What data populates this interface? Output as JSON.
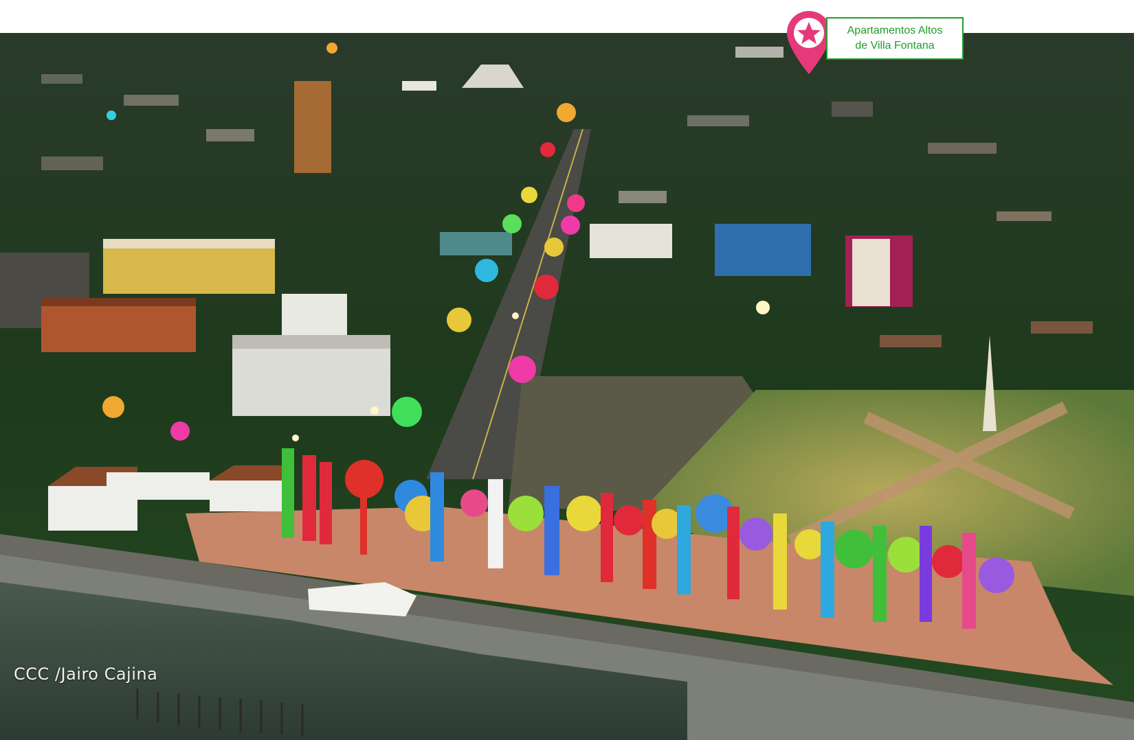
{
  "photo": {
    "description_icon": "aerial-city-photo",
    "colors": {
      "sky_band": "#ffffff",
      "water": "#3c4d43",
      "vegetation": "#1f3a1e",
      "plaza": "#c87a5a",
      "lawn": "#7f8f3f"
    }
  },
  "marker": {
    "icon": "star-pin-icon",
    "color": "#e6397a",
    "label_line1": "Apartamentos Altos",
    "label_line2": "de Villa Fontana",
    "label_color": "#1f9e2a"
  },
  "credit": {
    "text": "CCC /Jairo Cajina"
  }
}
